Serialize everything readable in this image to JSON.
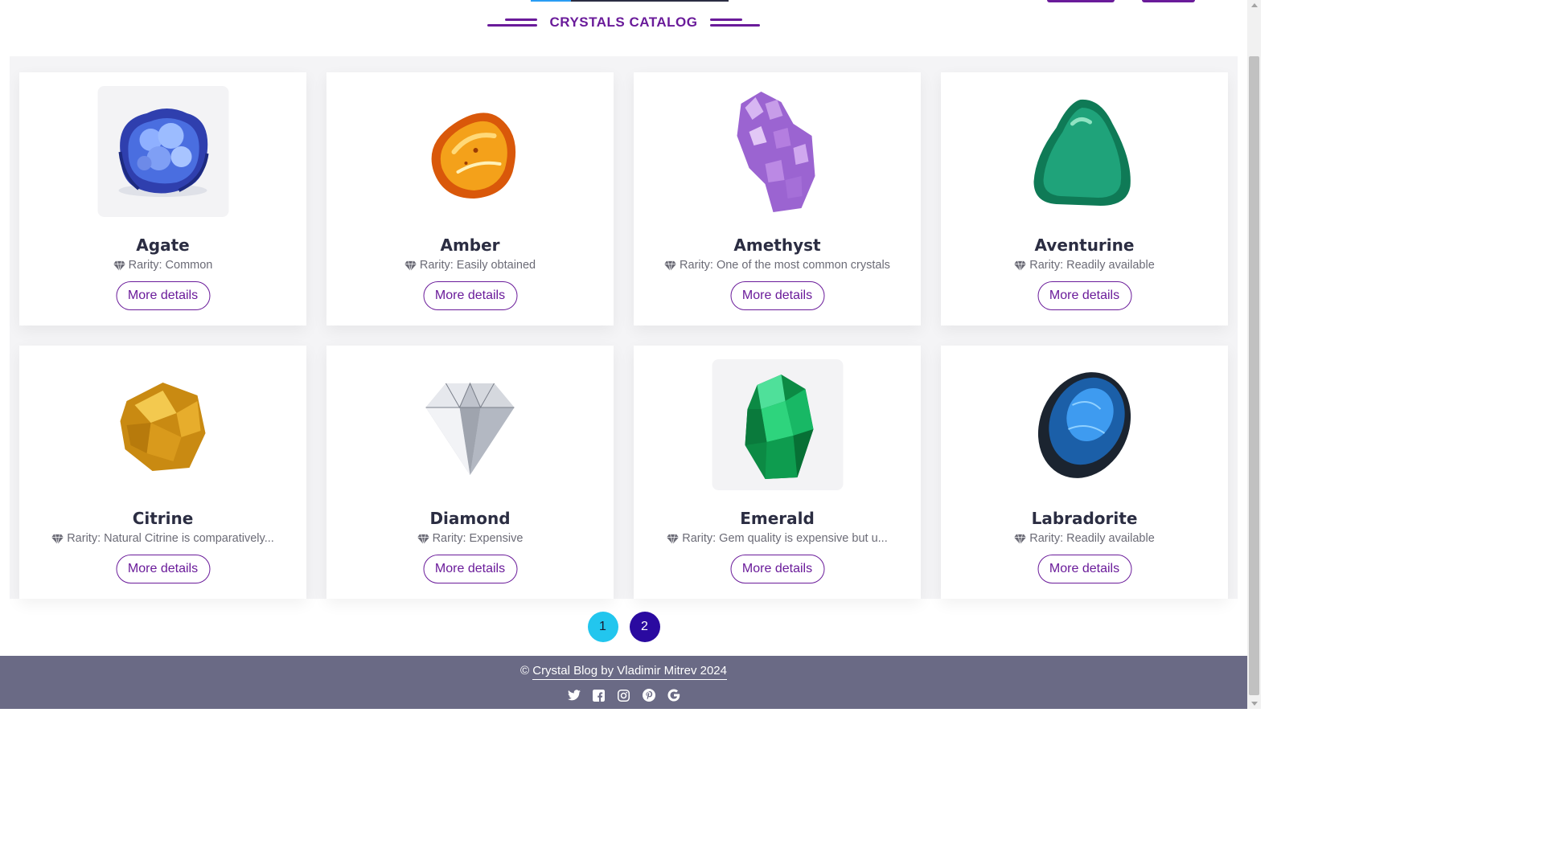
{
  "section": {
    "title": "CRYSTALS CATALOG"
  },
  "crystals": [
    {
      "name": "Agate",
      "rarity": "Rarity: Common",
      "button": "More details",
      "image": "blue-geode",
      "color": "#3f57c9"
    },
    {
      "name": "Amber",
      "rarity": "Rarity: Easily obtained",
      "button": "More details",
      "image": "amber-stone",
      "color": "#e8870b"
    },
    {
      "name": "Amethyst",
      "rarity": "Rarity: One of the most common crystals",
      "button": "More details",
      "image": "amethyst-cluster",
      "color": "#a77ad6"
    },
    {
      "name": "Aventurine",
      "rarity": "Rarity: Readily available",
      "button": "More details",
      "image": "green-tumbled-stone",
      "color": "#1d8f6a"
    },
    {
      "name": "Citrine",
      "rarity": "Rarity: Natural Citrine is comparatively...",
      "button": "More details",
      "image": "citrine-rough",
      "color": "#d9a12b"
    },
    {
      "name": "Diamond",
      "rarity": "Rarity: Expensive",
      "button": "More details",
      "image": "diamond-cut",
      "color": "#c9ccd3"
    },
    {
      "name": "Emerald",
      "rarity": "Rarity: Gem quality is expensive but u...",
      "button": "More details",
      "image": "emerald-crystal",
      "color": "#12a157"
    },
    {
      "name": "Labradorite",
      "rarity": "Rarity: Readily available",
      "button": "More details",
      "image": "labradorite-cabochon",
      "color": "#1f6fc2"
    }
  ],
  "pagination": {
    "pages": [
      "1",
      "2"
    ],
    "current": "1"
  },
  "footer": {
    "copyright_symbol": "©",
    "copyright_link": "Crystal Blog by Vladimir Mitrev 2024",
    "social_icons": [
      "twitter-icon",
      "facebook-icon",
      "instagram-icon",
      "pinterest-icon",
      "google-icon"
    ]
  },
  "colors": {
    "accent": "#6a1b9a",
    "footer_bg": "#6a6a85",
    "page_active": "#22c6ee",
    "page_other": "#2a0aa0"
  }
}
